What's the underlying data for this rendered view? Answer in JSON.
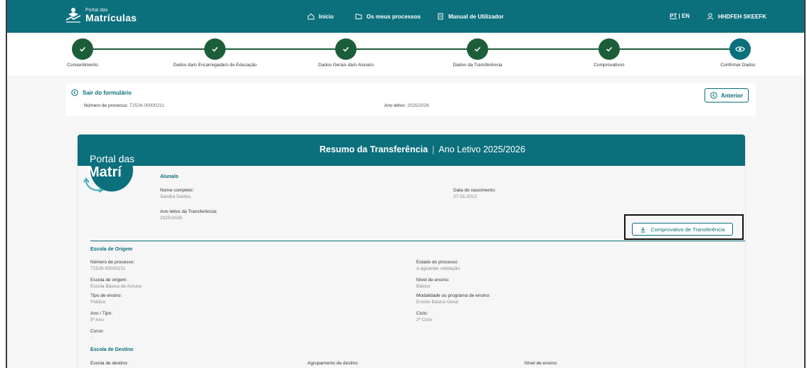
{
  "header": {
    "logo_small": "Portal das",
    "logo_big": "Matrículas",
    "nav": [
      {
        "label": "Início",
        "icon": "home-icon"
      },
      {
        "label": "Os meus processos",
        "icon": "folder-icon"
      },
      {
        "label": "Manual de Utilizador",
        "icon": "document-icon"
      }
    ],
    "lang_pt": "PT",
    "lang_sep": "|",
    "lang_en": "EN",
    "user_name": "HHDFEH SKEEFK"
  },
  "stepper": {
    "steps": [
      {
        "label": "Consentimento",
        "status": "done"
      },
      {
        "label": "Dados da/o Encarregada/o de Educação",
        "status": "done"
      },
      {
        "label": "Dados Gerais da/o Aluna/o",
        "status": "done"
      },
      {
        "label": "Dados da Transferência",
        "status": "done"
      },
      {
        "label": "Comprovativos",
        "status": "done"
      },
      {
        "label": "Confirmar Dados",
        "status": "current"
      }
    ]
  },
  "process": {
    "exit_label": "Sair do formulário",
    "numero_label": "Número de processo:",
    "numero_value": "T2526-00000211",
    "ano_label": "Ano letivo:",
    "ano_value": "2025/2026",
    "prev_label": "Anterior"
  },
  "summary": {
    "title_bold": "Resumo da Transferência",
    "title_sep": "|",
    "title_rest": "Ano Letivo 2025/2026",
    "brand_top": "Portal das",
    "brand_big": "Matrí",
    "aluno": {
      "section": "Aluna/o",
      "nome_label": "Nome completo:",
      "nome_value": "Sandra Santos",
      "nasc_label": "Data de nascimento:",
      "nasc_value": "27-01-2012",
      "ano_label": "Ano letivo da Transferência:",
      "ano_value": "2025/2026"
    },
    "download_label": "Comprovativo de Transferência",
    "origem": {
      "section": "Escola de Origem",
      "num_label": "Número de processo:",
      "num_value": "T2526-00000211",
      "estado_label": "Estado do processo:",
      "estado_value": "A aguardar validação",
      "escola_label": "Escola de origem:",
      "escola_value": "Escola Básica de Arouca",
      "nivel_label": "Nível de ensino:",
      "nivel_value": "Básico",
      "tipo_label": "Tipo de ensino:",
      "tipo_value": "Público",
      "modalidade_label": "Modalidade ou programa de ensino:",
      "modalidade_value": "Ensino Básico Geral",
      "ano_tipo_label": "Ano / Tipo:",
      "ano_tipo_value": "5º Ano",
      "ciclo_label": "Ciclo:",
      "ciclo_value": "2º Ciclo",
      "curso_label": "Curso:",
      "curso_value": "-"
    },
    "destino": {
      "section": "Escola de Destino",
      "escola_label": "Escola de destino:",
      "agrup_label": "Agrupamento de destino",
      "nivel_label": "Nível de ensino:"
    }
  }
}
